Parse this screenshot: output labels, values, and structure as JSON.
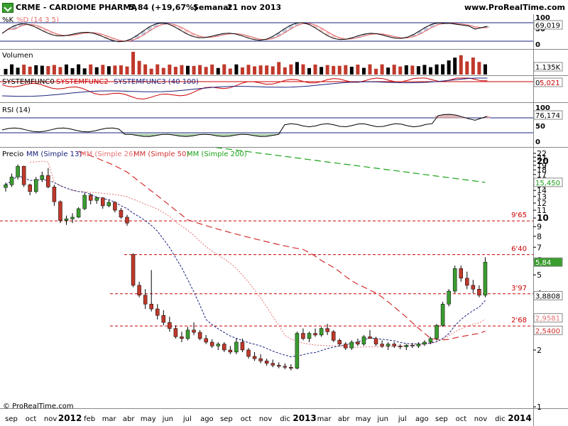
{
  "header": {
    "ticker_label": "CRME - CARDIOME PHARMA",
    "price_change": "5,84 (+19,67%)",
    "period": "Semanal",
    "date": "21 nov 2013",
    "site": "www.ProRealTime.com"
  },
  "credit": "© ProRealTime.com",
  "icons": {
    "logo": "prorealtime-logo-icon",
    "copyright": "copyright-icon"
  },
  "colors": {
    "up": "#3a9d2f",
    "down": "#c0392b",
    "mm13": "#1a237e",
    "mm26": "#e57373",
    "mm50": "#d32f2f",
    "mm200": "#1aa31a",
    "level": "#cc0000",
    "grid": "#1a237e"
  },
  "stochastic": {
    "label_k": "%K",
    "label_d": "%D (14 3 5)",
    "ticks": [
      "100",
      "50",
      "0"
    ],
    "value": "69,019"
  },
  "volume": {
    "label": "Volumen",
    "value": "1.135K"
  },
  "systemfunc": {
    "label_1": "SYSTEMFUNC0",
    "label_2": "SYSTEMFUNC2",
    "label_3": "SYSTEMFUNC3 (40 100)",
    "value": "0",
    "value2": "5,021"
  },
  "rsi": {
    "label": "RSI (14)",
    "ticks": [
      "100",
      "50",
      "0"
    ],
    "value": "76,174"
  },
  "price_panel": {
    "label_price": "Precio",
    "label_mm13": "MM (Simple 13)",
    "label_mm26": "MM (Simple 26)",
    "label_mm50": "MM (Simple 50)",
    "label_mm200": "MM (Simple 200)"
  },
  "chart_data": {
    "type": "candlestick",
    "y_scale": "log",
    "ylim": [
      1,
      22
    ],
    "y_ticks": [
      1,
      2,
      3,
      4,
      5,
      6,
      7,
      8,
      9,
      10,
      11,
      12,
      13,
      14,
      15,
      16,
      17,
      18,
      19,
      20,
      21,
      22
    ],
    "x_ticks": [
      "sep",
      "oct",
      "nov",
      "2012",
      "feb",
      "mar",
      "abr",
      "may",
      "jun",
      "jul",
      "ago",
      "sep",
      "oct",
      "nov",
      "dic",
      "2013",
      "mar",
      "abr",
      "may",
      "jun",
      "jul",
      "ago",
      "sep",
      "oct",
      "nov",
      "dic",
      "2014"
    ],
    "bold_x_ticks": [
      "2012",
      "2013",
      "2014"
    ],
    "levels": [
      {
        "label": "9'65",
        "value": 9.65
      },
      {
        "label": "6'40",
        "value": 6.4
      },
      {
        "label": "3'97",
        "value": 3.97
      },
      {
        "label": "2'68",
        "value": 2.68
      }
    ],
    "last_price": {
      "label": "5,84",
      "value": 5.84
    },
    "indicator_values": [
      {
        "name": "MM (Simple 200)",
        "label": "15,450",
        "value": 15.45
      },
      {
        "name": "MM (Simple 13)",
        "label": "3,8808",
        "value": 3.88
      },
      {
        "name": "MM (Simple 26)",
        "label": "2,9581",
        "value": 2.96
      },
      {
        "name": "MM (Simple 50)",
        "label": "2,5400",
        "value": 2.54
      }
    ],
    "candles": [
      [
        14.5,
        15.4,
        13.8,
        15
      ],
      [
        15,
        17.2,
        14.6,
        16.5
      ],
      [
        16.5,
        19.2,
        16,
        18.8
      ],
      [
        18.8,
        18.9,
        14.6,
        15
      ],
      [
        15,
        15.2,
        13.2,
        13.8
      ],
      [
        13.8,
        16.5,
        13.5,
        16
      ],
      [
        16,
        17.6,
        15.5,
        16.8
      ],
      [
        16.8,
        18.4,
        14.4,
        14.6
      ],
      [
        14.6,
        15,
        11.6,
        12.2
      ],
      [
        12.2,
        12.4,
        9.4,
        9.7
      ],
      [
        9.7,
        10.3,
        9.2,
        9.9
      ],
      [
        9.9,
        10.6,
        9.4,
        10.1
      ],
      [
        10.1,
        11.4,
        10,
        11.2
      ],
      [
        11.2,
        13.6,
        11,
        13.2
      ],
      [
        13.2,
        13.5,
        11.8,
        12.4
      ],
      [
        12.4,
        13,
        11.9,
        12.8
      ],
      [
        12.8,
        12.9,
        11.2,
        11.6
      ],
      [
        11.6,
        12.5,
        11.4,
        12.1
      ],
      [
        12.1,
        12.3,
        10.7,
        11
      ],
      [
        11,
        11.3,
        9.9,
        10.1
      ],
      [
        10.1,
        10.4,
        9.1,
        9.4
      ],
      [
        6.4,
        6.5,
        4.3,
        4.4
      ],
      [
        4.4,
        4.6,
        3.8,
        3.9
      ],
      [
        3.9,
        4.2,
        3.3,
        3.5
      ],
      [
        3.5,
        5.3,
        3.2,
        3.3
      ],
      [
        3.3,
        3.5,
        2.9,
        3.05
      ],
      [
        3.05,
        3.25,
        2.7,
        2.8
      ],
      [
        2.8,
        3,
        2.5,
        2.6
      ],
      [
        2.6,
        2.7,
        2.3,
        2.35
      ],
      [
        2.35,
        2.5,
        2.2,
        2.3
      ],
      [
        2.3,
        2.65,
        2.25,
        2.55
      ],
      [
        2.55,
        2.8,
        2.4,
        2.48
      ],
      [
        2.48,
        2.55,
        2.25,
        2.3
      ],
      [
        2.3,
        2.4,
        2.15,
        2.2
      ],
      [
        2.2,
        2.28,
        2.05,
        2.1
      ],
      [
        2.1,
        2.2,
        2,
        2.15
      ],
      [
        2.15,
        2.2,
        1.95,
        2
      ],
      [
        2,
        2.1,
        1.9,
        1.95
      ],
      [
        1.95,
        2.3,
        1.9,
        2.2
      ],
      [
        2.2,
        2.3,
        1.95,
        2
      ],
      [
        2,
        2.05,
        1.8,
        1.85
      ],
      [
        1.85,
        1.95,
        1.75,
        1.8
      ],
      [
        1.8,
        1.9,
        1.7,
        1.75
      ],
      [
        1.75,
        1.8,
        1.65,
        1.7
      ],
      [
        1.7,
        1.78,
        1.62,
        1.66
      ],
      [
        1.66,
        1.72,
        1.6,
        1.64
      ],
      [
        1.64,
        1.7,
        1.58,
        1.62
      ],
      [
        1.62,
        1.68,
        1.56,
        1.6
      ],
      [
        1.6,
        2.5,
        1.58,
        2.45
      ],
      [
        2.45,
        2.6,
        2.25,
        2.3
      ],
      [
        2.3,
        2.5,
        2.2,
        2.45
      ],
      [
        2.45,
        2.6,
        2.35,
        2.4
      ],
      [
        2.4,
        2.65,
        2.35,
        2.6
      ],
      [
        2.6,
        2.75,
        2.4,
        2.5
      ],
      [
        2.5,
        2.55,
        2.2,
        2.25
      ],
      [
        2.25,
        2.3,
        2.1,
        2.15
      ],
      [
        2.15,
        2.2,
        2,
        2.05
      ],
      [
        2.05,
        2.25,
        2,
        2.2
      ],
      [
        2.2,
        2.3,
        2.1,
        2.15
      ],
      [
        2.15,
        2.4,
        2.1,
        2.35
      ],
      [
        2.35,
        2.55,
        2.3,
        2.3
      ],
      [
        2.3,
        2.35,
        2.1,
        2.15
      ],
      [
        2.15,
        2.25,
        2.05,
        2.1
      ],
      [
        2.1,
        2.2,
        2,
        2.15
      ],
      [
        2.15,
        2.2,
        2.05,
        2.1
      ],
      [
        2.1,
        2.15,
        2.02,
        2.08
      ],
      [
        2.08,
        2.15,
        2,
        2.12
      ],
      [
        2.12,
        2.18,
        2.05,
        2.1
      ],
      [
        2.1,
        2.2,
        2.05,
        2.15
      ],
      [
        2.15,
        2.25,
        2.1,
        2.2
      ],
      [
        2.2,
        2.35,
        2.15,
        2.3
      ],
      [
        2.3,
        2.75,
        2.25,
        2.7
      ],
      [
        2.7,
        3.6,
        2.65,
        3.5
      ],
      [
        3.5,
        4.2,
        3.4,
        4.1
      ],
      [
        4.1,
        5.6,
        4,
        5.4
      ],
      [
        5.4,
        5.6,
        4.6,
        4.8
      ],
      [
        4.8,
        5.2,
        4.2,
        4.4
      ],
      [
        4.4,
        4.7,
        4,
        4.2
      ],
      [
        4.2,
        4.4,
        3.8,
        3.9
      ],
      [
        3.9,
        6.2,
        3.8,
        5.84
      ]
    ]
  }
}
